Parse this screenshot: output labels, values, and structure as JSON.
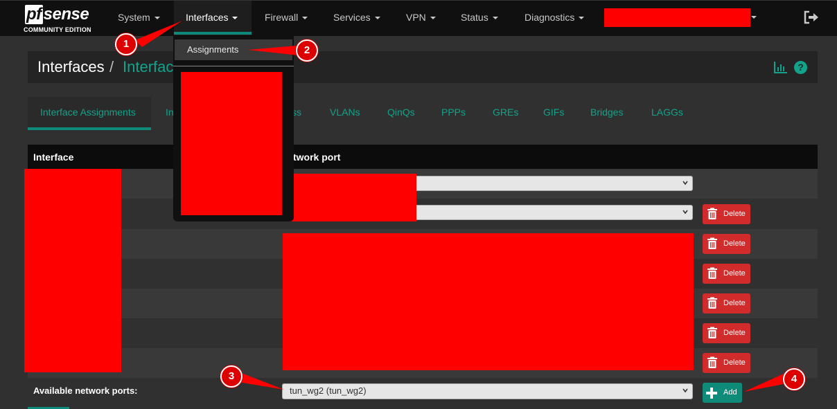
{
  "brand": {
    "name_prefix": "pf",
    "name_main": "sense",
    "edition": "COMMUNITY EDITION"
  },
  "navbar": {
    "items": [
      {
        "label": "System"
      },
      {
        "label": "Interfaces"
      },
      {
        "label": "Firewall"
      },
      {
        "label": "Services"
      },
      {
        "label": "VPN"
      },
      {
        "label": "Status"
      },
      {
        "label": "Diagnostics"
      }
    ],
    "active": "Interfaces"
  },
  "dropdown": {
    "items": [
      {
        "label": "Assignments"
      }
    ]
  },
  "breadcrumb": {
    "root": "Interfaces",
    "separator": "/",
    "current": "Interfac"
  },
  "tabs": [
    {
      "label": "Interface Assignments"
    },
    {
      "label": "In"
    },
    {
      "label": "ss"
    },
    {
      "label": "VLANs"
    },
    {
      "label": "QinQs"
    },
    {
      "label": "PPPs"
    },
    {
      "label": "GREs"
    },
    {
      "label": "GIFs"
    },
    {
      "label": "Bridges"
    },
    {
      "label": "LAGGs"
    }
  ],
  "table": {
    "headers": {
      "interface": "Interface",
      "network_port": "twork port"
    },
    "delete_label": "Delete",
    "available_label": "Available network ports:",
    "available_value": "tun_wg2 (tun_wg2)",
    "add_label": "Add"
  },
  "annotations": [
    "1",
    "2",
    "3",
    "4"
  ],
  "colors": {
    "accent": "#11a38b",
    "danger": "#d12b2b",
    "redaction": "#ff0000"
  }
}
